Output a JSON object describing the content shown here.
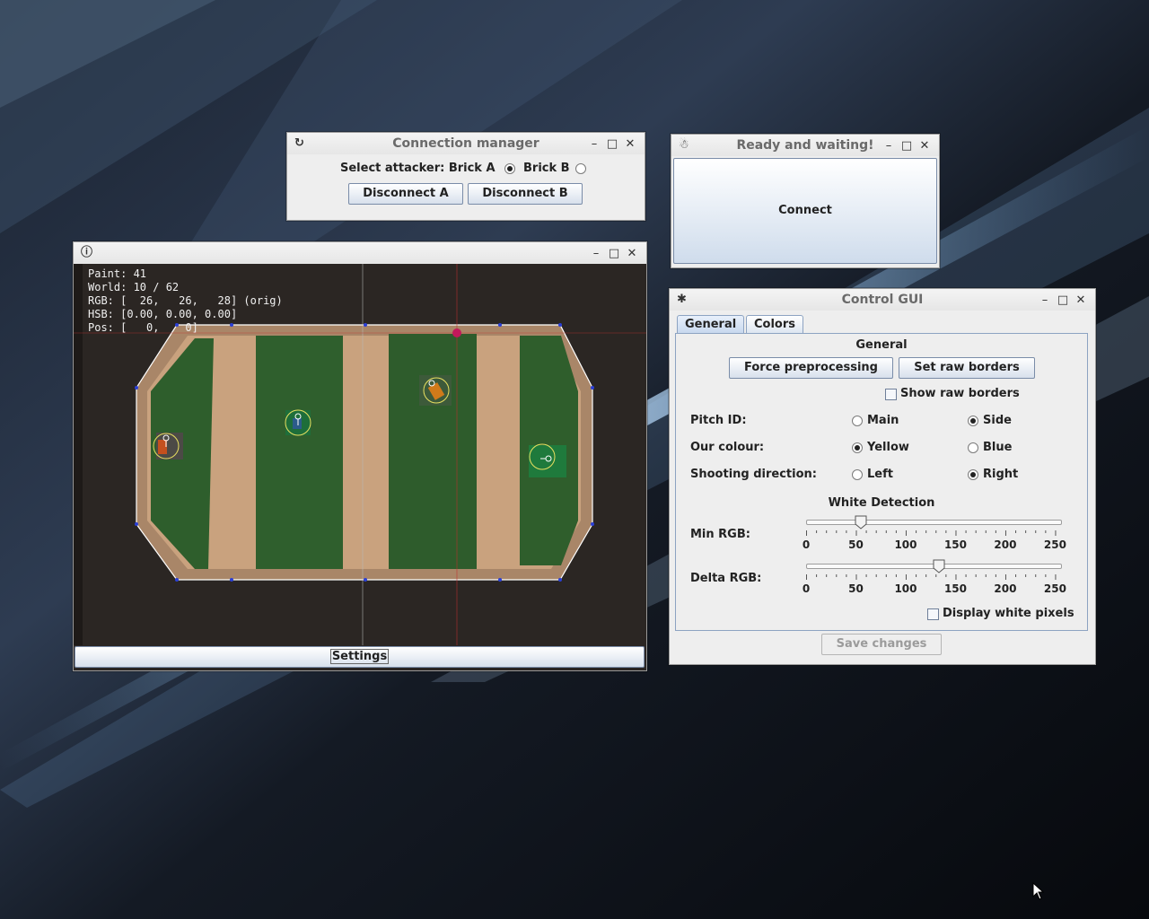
{
  "connection_manager": {
    "title": "Connection manager",
    "select_label": "Select attacker: Brick A",
    "brick_b_label": "Brick B",
    "selected_brick": "Brick A",
    "disconnect_a": "Disconnect A",
    "disconnect_b": "Disconnect B"
  },
  "ready_window": {
    "title": "Ready and waiting!",
    "connect_label": "Connect"
  },
  "vision_window": {
    "settings_label": "Settings",
    "overlay": {
      "paint": "Paint: 41",
      "world": "World: 10 / 62",
      "rgb": "RGB: [  26,   26,   28] (orig)",
      "hsb": "HSB: [0.00, 0.00, 0.00]",
      "pos": "Pos: [   0,    0]"
    }
  },
  "control_gui": {
    "title": "Control GUI",
    "tabs": [
      {
        "label": "General",
        "active": true
      },
      {
        "label": "Colors",
        "active": false
      }
    ],
    "section_general": "General",
    "force_preprocessing": "Force preprocessing",
    "set_raw_borders": "Set raw borders",
    "show_raw_borders": {
      "label": "Show raw borders",
      "checked": false
    },
    "pitch_id": {
      "label": "Pitch ID:",
      "options": [
        "Main",
        "Side"
      ],
      "selected": "Side"
    },
    "our_colour": {
      "label": "Our colour:",
      "options": [
        "Yellow",
        "Blue"
      ],
      "selected": "Yellow"
    },
    "shooting_direction": {
      "label": "Shooting direction:",
      "options": [
        "Left",
        "Right"
      ],
      "selected": "Right"
    },
    "white_detection": "White Detection",
    "min_rgb": {
      "label": "Min RGB:",
      "value": 55
    },
    "delta_rgb": {
      "label": "Delta RGB:",
      "value": 133
    },
    "slider_ticks": [
      "0",
      "50",
      "100",
      "150",
      "200",
      "250"
    ],
    "display_white_pixels": {
      "label": "Display white pixels",
      "checked": false
    },
    "save_changes": "Save changes"
  }
}
